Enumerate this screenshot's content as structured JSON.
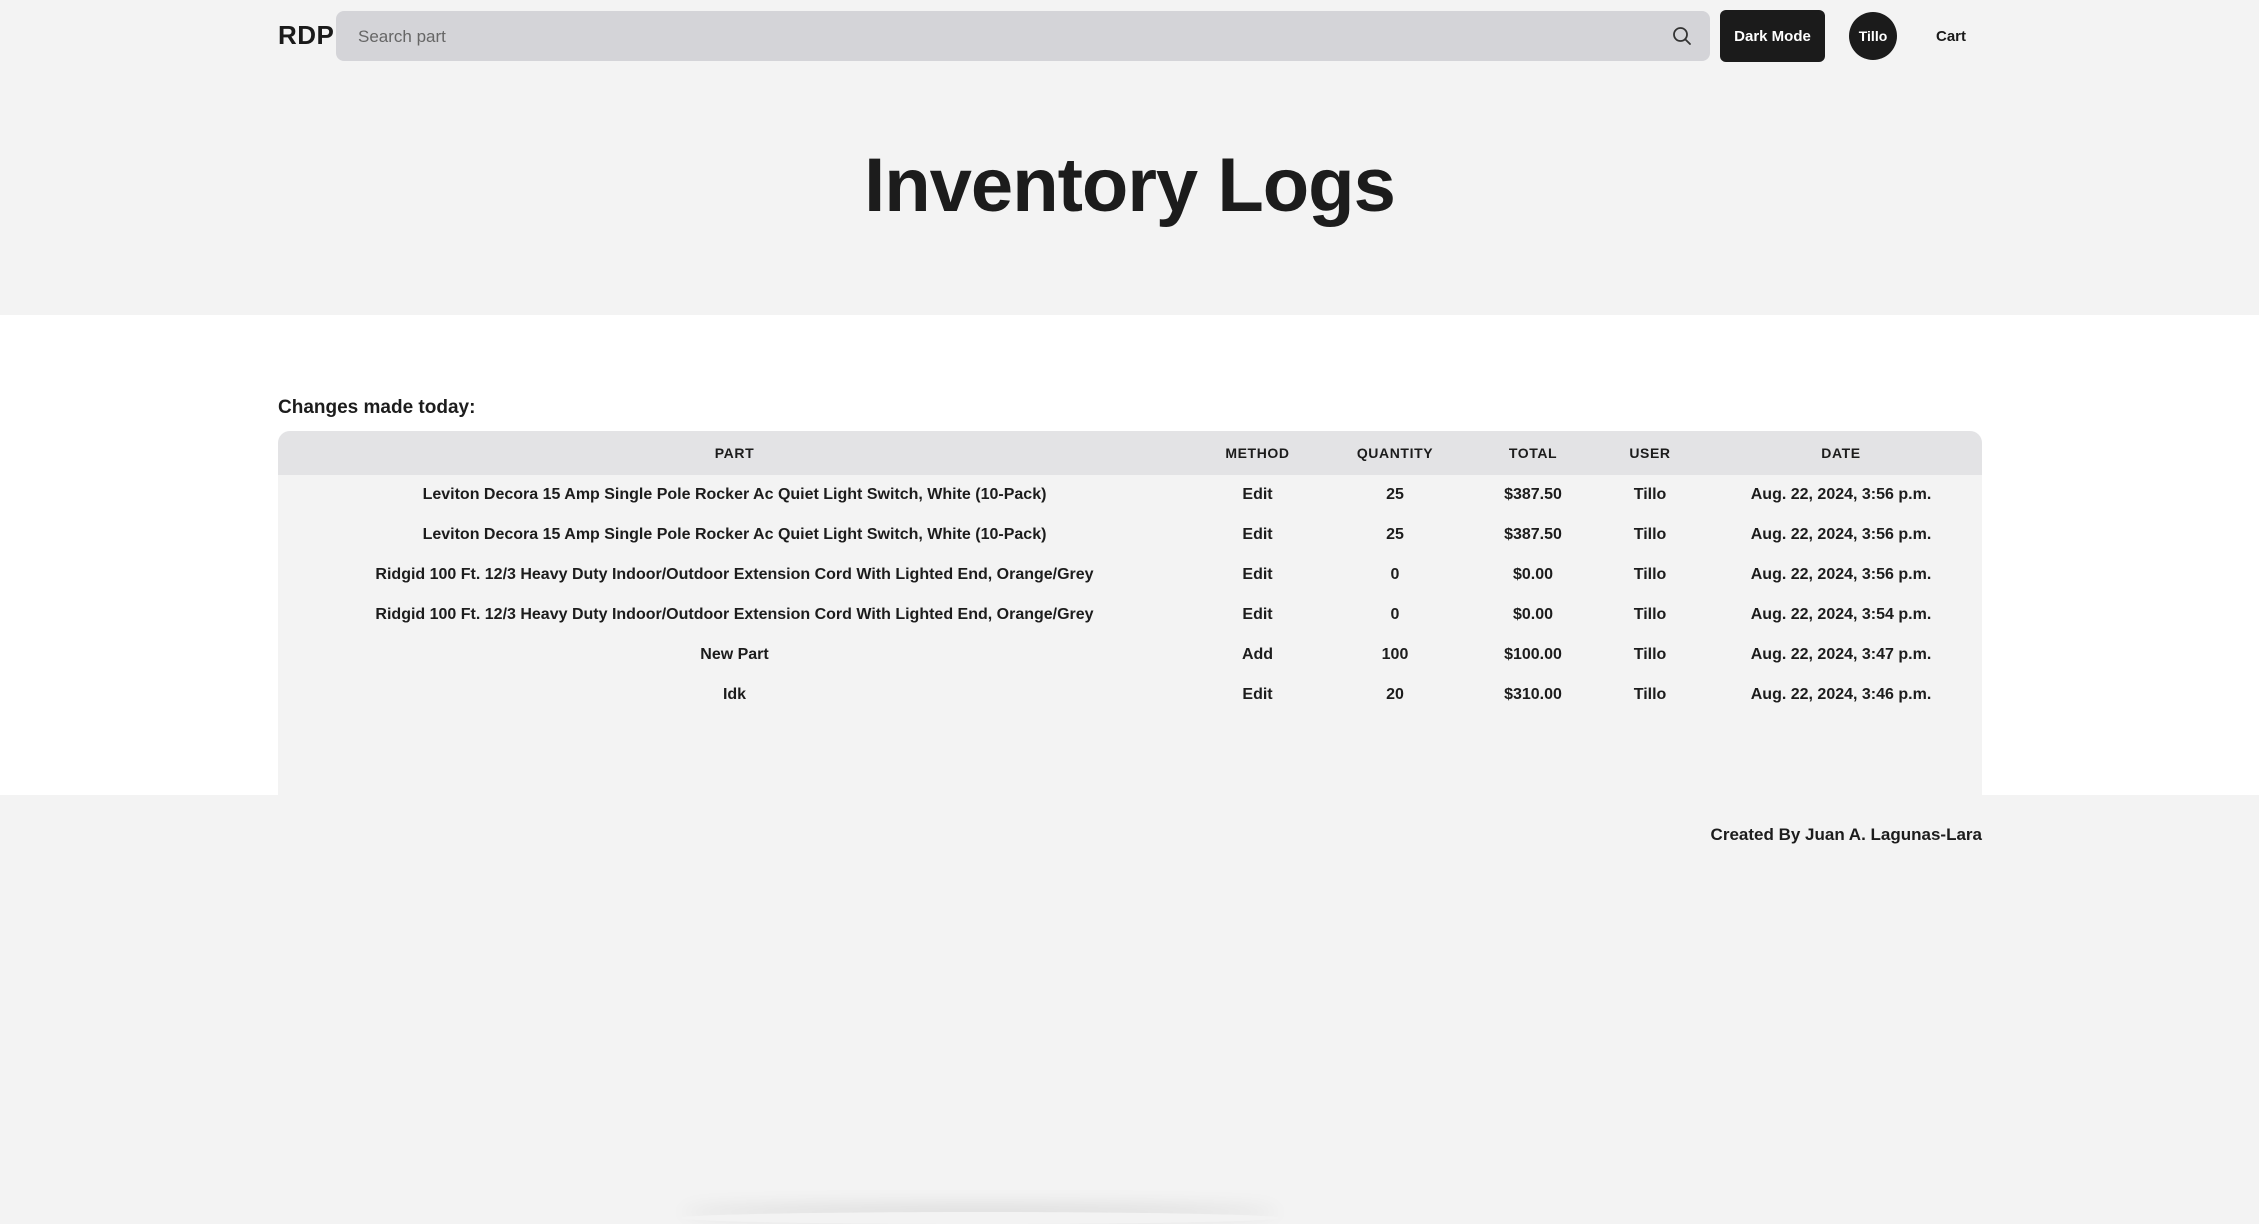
{
  "header": {
    "brand": "RDP",
    "search_placeholder": "Search part",
    "dark_mode_label": "Dark Mode",
    "user_avatar_label": "Tillo",
    "cart_label": "Cart"
  },
  "page": {
    "title": "Inventory Logs",
    "subheading": "Changes made today:"
  },
  "table": {
    "columns": [
      "PART",
      "METHOD",
      "QUANTITY",
      "TOTAL",
      "USER",
      "DATE"
    ],
    "rows": [
      {
        "part": "Leviton Decora 15 Amp Single Pole Rocker Ac Quiet Light Switch, White (10-Pack)",
        "method": "Edit",
        "quantity": "25",
        "total": "$387.50",
        "user": "Tillo",
        "date": "Aug. 22, 2024, 3:56 p.m."
      },
      {
        "part": "Leviton Decora 15 Amp Single Pole Rocker Ac Quiet Light Switch, White (10-Pack)",
        "method": "Edit",
        "quantity": "25",
        "total": "$387.50",
        "user": "Tillo",
        "date": "Aug. 22, 2024, 3:56 p.m."
      },
      {
        "part": "Ridgid 100 Ft. 12/3 Heavy Duty Indoor/Outdoor Extension Cord With Lighted End, Orange/Grey",
        "method": "Edit",
        "quantity": "0",
        "total": "$0.00",
        "user": "Tillo",
        "date": "Aug. 22, 2024, 3:56 p.m."
      },
      {
        "part": "Ridgid 100 Ft. 12/3 Heavy Duty Indoor/Outdoor Extension Cord With Lighted End, Orange/Grey",
        "method": "Edit",
        "quantity": "0",
        "total": "$0.00",
        "user": "Tillo",
        "date": "Aug. 22, 2024, 3:54 p.m."
      },
      {
        "part": "New Part",
        "method": "Add",
        "quantity": "100",
        "total": "$100.00",
        "user": "Tillo",
        "date": "Aug. 22, 2024, 3:47 p.m."
      },
      {
        "part": "Idk",
        "method": "Edit",
        "quantity": "20",
        "total": "$310.00",
        "user": "Tillo",
        "date": "Aug. 22, 2024, 3:46 p.m."
      }
    ]
  },
  "footer": {
    "credit": "Created By Juan A. Lagunas-Lara"
  },
  "colors": {
    "page_background": "#f3f3f3",
    "content_background": "#ffffff",
    "search_background": "#d4d4d8",
    "button_dark": "#1b1b1b",
    "table_header": "#e3e3e5"
  }
}
